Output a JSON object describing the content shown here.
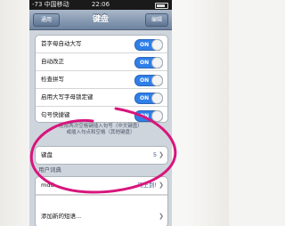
{
  "statusbar": {
    "carrier": "-73 中国移动",
    "time": "22:06"
  },
  "navbar": {
    "back": "通用",
    "title": "键盘",
    "done": "编辑"
  },
  "settings": [
    {
      "label": "首字母自动大写",
      "state": "ON"
    },
    {
      "label": "自动改正",
      "state": "ON"
    },
    {
      "label": "检查拼写",
      "state": "ON"
    },
    {
      "label": "启用大写字母锁定键",
      "state": "ON"
    },
    {
      "label": "句号快捷键",
      "state": "ON"
    }
  ],
  "footnote": {
    "line1": "连按两次空格键插入句号（中文键盘）",
    "line2": "或插入句点和空格（其他键盘）"
  },
  "keyboards": {
    "label": "键盘",
    "value": "5"
  },
  "user_dictionary": {
    "header": "用户词典",
    "shortcut_label": "mdd",
    "shortcut_value": "马上到!",
    "add_label": "添加新的短语..."
  },
  "annotation_color": "#d8157c"
}
